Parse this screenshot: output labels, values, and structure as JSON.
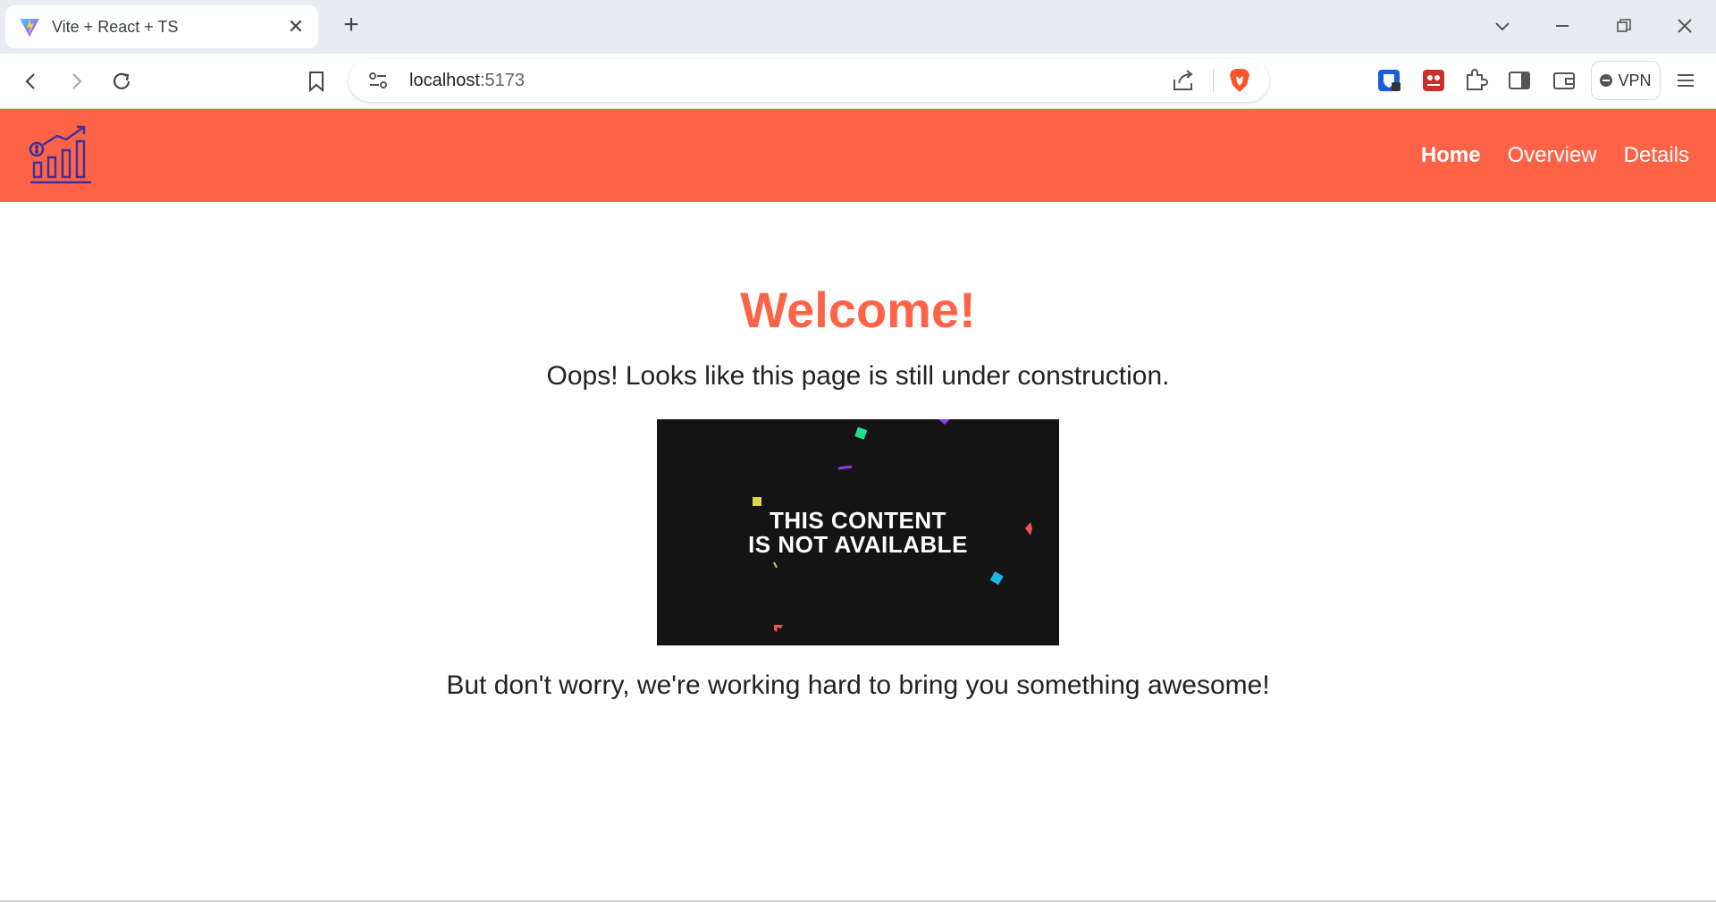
{
  "browser": {
    "tab": {
      "title": "Vite + React + TS",
      "close_glyph": "✕"
    },
    "new_tab_glyph": "+",
    "window_controls": {
      "dropdown": "⌄",
      "minimize": "—",
      "restore": "❐",
      "close": "✕"
    },
    "url": {
      "host": "localhost",
      "port": ":5173"
    },
    "vpn_label": "VPN",
    "menu_glyph": "☰"
  },
  "colors": {
    "brand": "#ff6347",
    "logo_stroke": "#3d3199"
  },
  "header": {
    "nav": [
      "Home",
      "Overview",
      "Details"
    ],
    "active": "Home"
  },
  "main": {
    "title": "Welcome!",
    "subtitle": "Oops! Looks like this page is still under construction.",
    "video_message_line1": "THIS CONTENT",
    "video_message_line2": "IS NOT AVAILABLE",
    "footer": "But don't worry, we're working hard to bring you something awesome!"
  }
}
